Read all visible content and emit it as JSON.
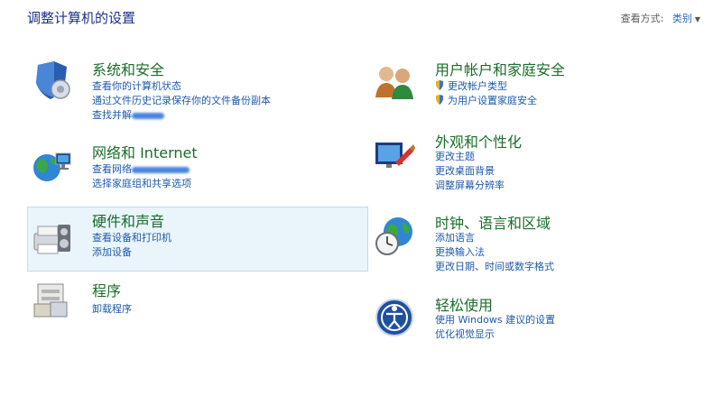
{
  "header": {
    "title": "调整计算机的设置",
    "view_by_label": "查看方式:",
    "view_by_value": "类别"
  },
  "categories": {
    "system": {
      "title": "系统和安全",
      "links": [
        "查看你的计算机状态",
        "通过文件历史记录保存你的文件备份副本",
        "查找并解"
      ]
    },
    "network": {
      "title": "网络和 Internet",
      "links": [
        "查看网络",
        "选择家庭组和共享选项"
      ]
    },
    "hardware": {
      "title": "硬件和声音",
      "links": [
        "查看设备和打印机",
        "添加设备"
      ]
    },
    "programs": {
      "title": "程序",
      "links": [
        "卸载程序"
      ]
    },
    "user_accounts": {
      "title": "用户帐户和家庭安全",
      "links": [
        "更改帐户类型",
        "为用户设置家庭安全"
      ]
    },
    "appearance": {
      "title": "外观和个性化",
      "links": [
        "更改主题",
        "更改桌面背景",
        "调整屏幕分辨率"
      ]
    },
    "clock": {
      "title": "时钟、语言和区域",
      "links": [
        "添加语言",
        "更换输入法",
        "更改日期、时间或数字格式"
      ]
    },
    "ease": {
      "title": "轻松使用",
      "links": [
        "使用 Windows 建议的设置",
        "优化视觉显示"
      ]
    }
  },
  "icons": {
    "system": "shield-icon",
    "network": "network-globe-icon",
    "hardware": "printer-speaker-icon",
    "programs": "programs-icon",
    "user_accounts": "users-icon",
    "appearance": "appearance-icon",
    "clock": "clock-globe-icon",
    "ease": "ease-of-access-icon",
    "uac": "uac-shield-icon"
  },
  "colors": {
    "title_blue": "#1e3287",
    "category_green": "#1b6d2a",
    "link_blue": "#1e5aab",
    "highlight_bg": "#eaf4fb",
    "highlight_border": "#bcdcf1"
  }
}
